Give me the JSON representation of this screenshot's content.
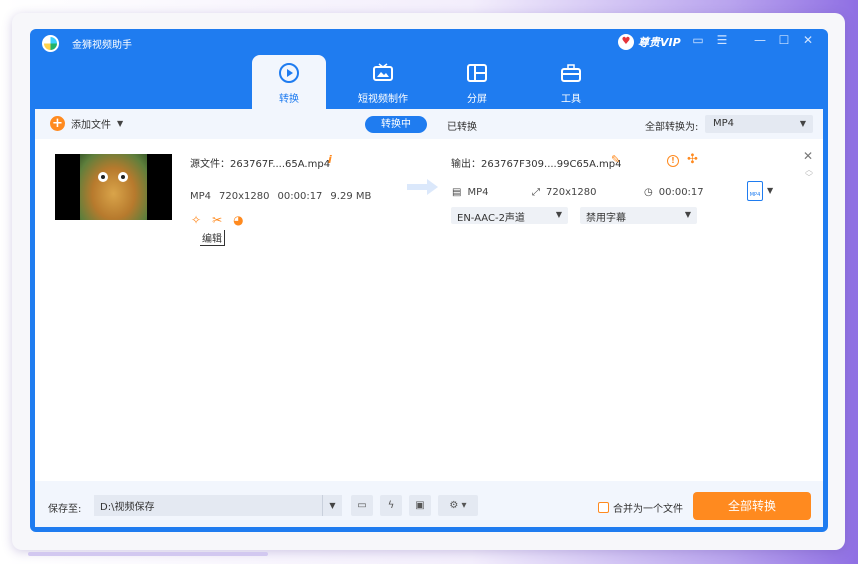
{
  "app": {
    "title": "金狮视频助手"
  },
  "vip": {
    "label": "尊贵VIP"
  },
  "tabs": [
    {
      "label": "转换",
      "active": true
    },
    {
      "label": "短视频制作",
      "active": false
    },
    {
      "label": "分屏",
      "active": false
    },
    {
      "label": "工具",
      "active": false
    }
  ],
  "toolbar": {
    "add_file": "添加文件",
    "converting": "转换中",
    "converted": "已转换",
    "convert_all_to": "全部转换为:",
    "format": "MP4"
  },
  "file": {
    "source": "源文件：263767F....65A.mp4",
    "format": "MP4",
    "resolution": "720x1280",
    "duration": "00:00:17",
    "size": "9.29 MB",
    "edit_tooltip": "编辑",
    "output": "输出：263767F309....99C65A.mp4",
    "out_format": "MP4",
    "out_resolution": "720x1280",
    "out_duration": "00:00:17",
    "audio_track": "EN-AAC-2声道",
    "subtitle": "禁用字幕"
  },
  "bottom": {
    "save_to": "保存至:",
    "path": "D:\\视频保存",
    "merge": "合并为一个文件",
    "convert_all": "全部转换"
  },
  "colors": {
    "primary": "#1f7cf0",
    "accent": "#ff8a1f"
  }
}
